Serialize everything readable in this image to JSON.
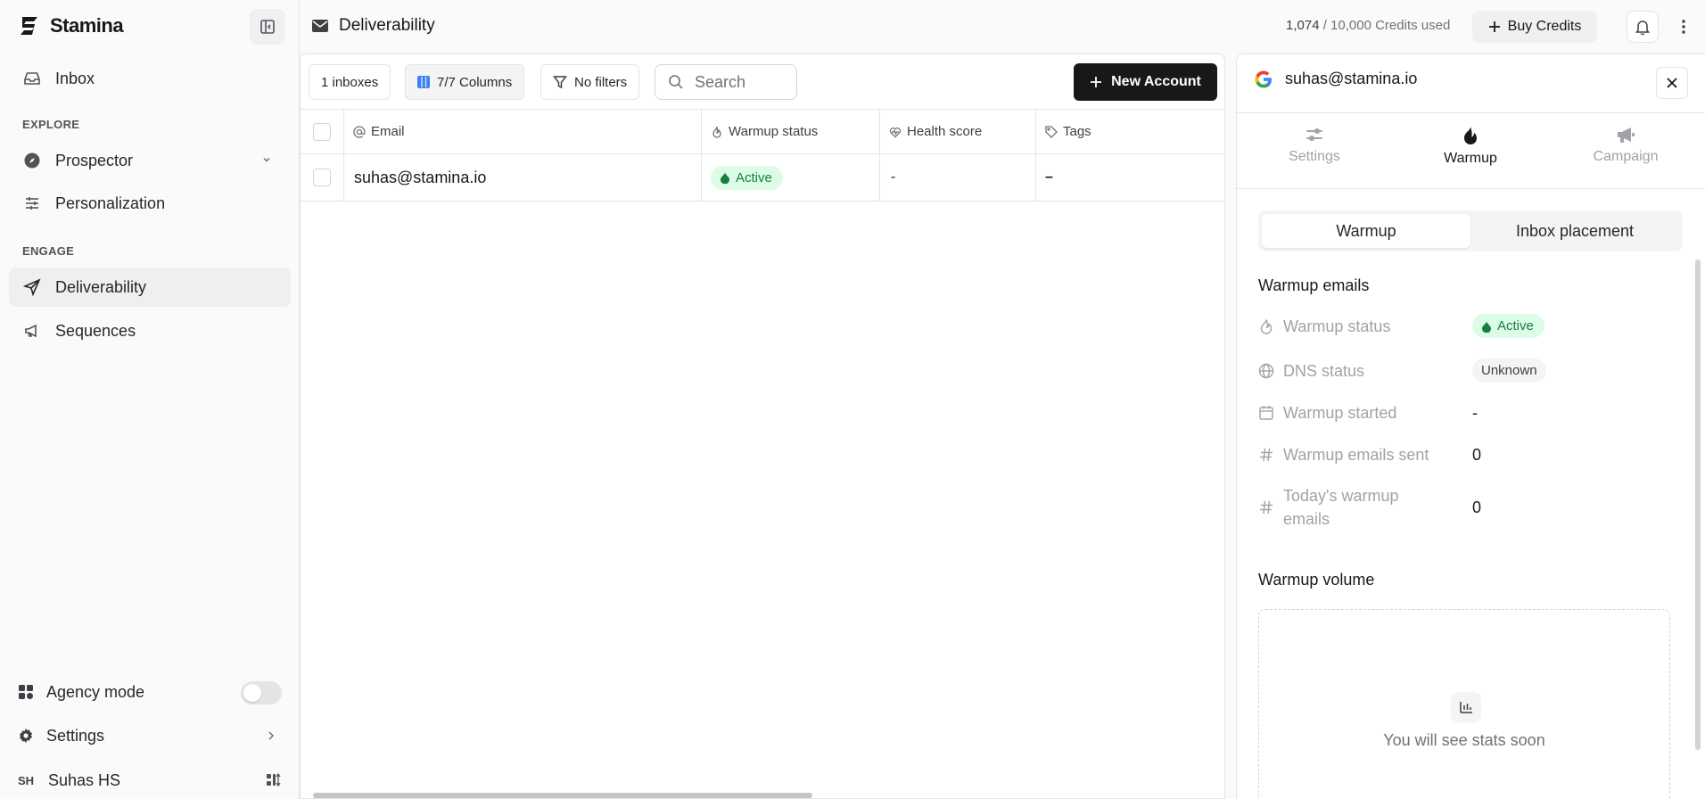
{
  "brand": {
    "name": "Stamina"
  },
  "sidebar": {
    "inbox": "Inbox",
    "explore_label": "EXPLORE",
    "prospector": "Prospector",
    "personalization": "Personalization",
    "engage_label": "ENGAGE",
    "deliverability": "Deliverability",
    "sequences": "Sequences",
    "agency_mode": "Agency mode",
    "settings": "Settings",
    "user_initials": "SH",
    "user_name": "Suhas HS"
  },
  "header": {
    "title": "Deliverability",
    "credits_used": "1,074",
    "credits_total": "/ 10,000 Credits used",
    "buy_credits": "Buy Credits"
  },
  "toolbar": {
    "inboxes": "1 inboxes",
    "columns": "7/7 Columns",
    "filters": "No filters",
    "search_placeholder": "Search",
    "new_account": "New Account"
  },
  "table": {
    "headers": [
      "Email",
      "Warmup status",
      "Health score",
      "Tags"
    ],
    "rows": [
      {
        "email": "suhas@stamina.io",
        "warmup_status": "Active",
        "health_score": "-",
        "tags": "–"
      }
    ]
  },
  "panel": {
    "email": "suhas@stamina.io",
    "tabs": [
      "Settings",
      "Warmup",
      "Campaign"
    ],
    "active_tab": "Warmup",
    "segments": [
      "Warmup",
      "Inbox placement"
    ],
    "warmup_emails_title": "Warmup emails",
    "fields": {
      "warmup_status_label": "Warmup status",
      "warmup_status_value": "Active",
      "dns_status_label": "DNS status",
      "dns_status_value": "Unknown",
      "warmup_started_label": "Warmup started",
      "warmup_started_value": "-",
      "emails_sent_label": "Warmup emails sent",
      "emails_sent_value": "0",
      "today_label": "Today's warmup emails",
      "today_value": "0"
    },
    "volume_title": "Warmup volume",
    "stats_placeholder": "You will see stats soon"
  },
  "colors": {
    "accent_dark": "#18181b",
    "active_green": "#15803d",
    "active_green_bg": "#dcfce7",
    "columns_icon_blue": "#3b82f6"
  }
}
